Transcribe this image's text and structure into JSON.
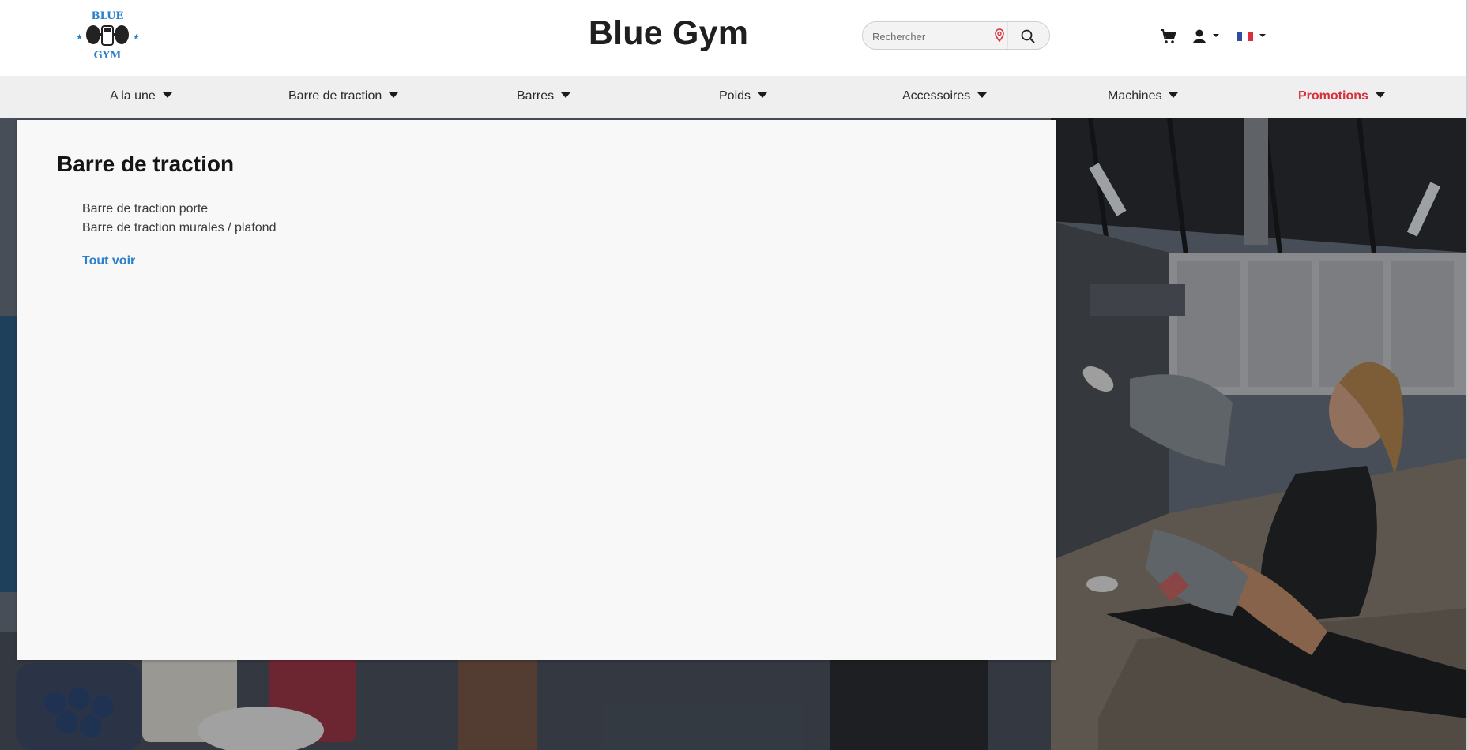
{
  "header": {
    "logo": {
      "text_top": "BLUE",
      "text_bottom": "GYM",
      "color": "#2c80c9"
    },
    "brand": "Blue Gym",
    "search": {
      "placeholder": "Rechercher",
      "icon": "search-icon"
    },
    "icons": [
      "cart-icon",
      "user-icon",
      "flag-fr-icon"
    ]
  },
  "nav": {
    "items": [
      {
        "label": "A la une"
      },
      {
        "label": "Barre de traction"
      },
      {
        "label": "Barres"
      },
      {
        "label": "Poids"
      },
      {
        "label": "Accessoires"
      },
      {
        "label": "Machines"
      },
      {
        "label": "Promotions",
        "color": "#d72f3c"
      }
    ]
  },
  "mega_menu": {
    "title": "Barre de traction",
    "links": [
      "Barre de traction porte",
      "Barre de traction murales / plafond"
    ],
    "view_all": "Tout voir",
    "link_color": "#2c80c9"
  }
}
